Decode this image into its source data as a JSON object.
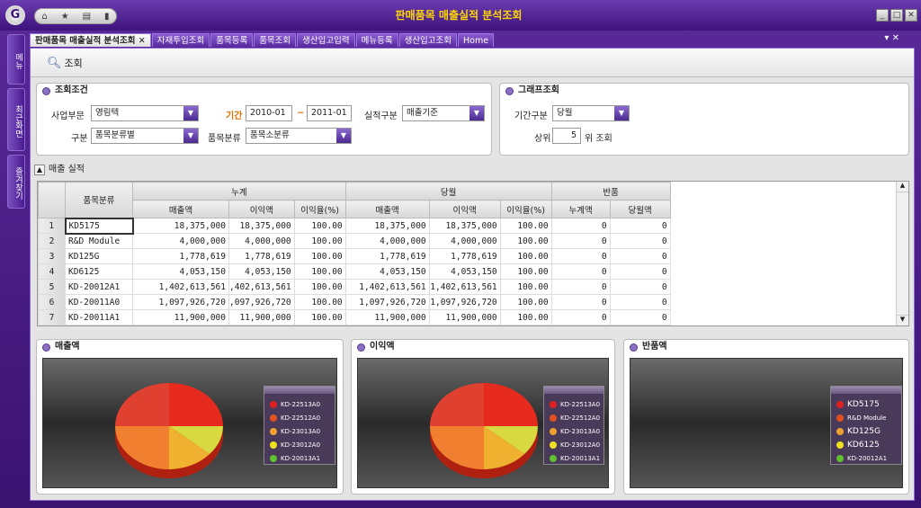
{
  "window": {
    "title": "판매품목 매출실적 분석조회",
    "logo": "G"
  },
  "left_tabs": [
    "메뉴",
    "최근화면",
    "즐겨찾기"
  ],
  "tabs": [
    {
      "label": "판매품목 매출실적 분석조회 ✕",
      "active": true
    },
    {
      "label": "자재투입조회"
    },
    {
      "label": "품목등록"
    },
    {
      "label": "품목조회"
    },
    {
      "label": "생산입고입력"
    },
    {
      "label": "메뉴등록"
    },
    {
      "label": "생산입고조회"
    },
    {
      "label": "Home"
    }
  ],
  "toolbar": {
    "search_label": "조회"
  },
  "conditions": {
    "title": "조회조건",
    "division_label": "사업부문",
    "division_value": "영림텍",
    "period_label": "기간",
    "period_from": "2010-01",
    "period_sep": "~",
    "period_to": "2011-01",
    "perf_label": "실적구분",
    "perf_value": "매출기준",
    "type_label": "구분",
    "type_value": "품목분류별",
    "item_class_label": "품목분류",
    "item_class_value": "품목소분류"
  },
  "graph_query": {
    "title": "그래프조회",
    "period_type_label": "기간구분",
    "period_type_value": "당월",
    "top_label": "상위",
    "top_value": "5",
    "top_suffix": "위 조회"
  },
  "section": {
    "title": "매출 실적"
  },
  "grid": {
    "group_headers": [
      "품목분류",
      "누계",
      "당월",
      "반품"
    ],
    "sub_headers": [
      "매출액",
      "이익액",
      "이익율(%)",
      "매출액",
      "이익액",
      "이익율(%)",
      "누계액",
      "당월액"
    ],
    "rows": [
      [
        "1",
        "KD5175",
        "18,375,000",
        "18,375,000",
        "100.00",
        "18,375,000",
        "18,375,000",
        "100.00",
        "0",
        "0"
      ],
      [
        "2",
        "R&D Module",
        "4,000,000",
        "4,000,000",
        "100.00",
        "4,000,000",
        "4,000,000",
        "100.00",
        "0",
        "0"
      ],
      [
        "3",
        "KD125G",
        "1,778,619",
        "1,778,619",
        "100.00",
        "1,778,619",
        "1,778,619",
        "100.00",
        "0",
        "0"
      ],
      [
        "4",
        "KD6125",
        "4,053,150",
        "4,053,150",
        "100.00",
        "4,053,150",
        "4,053,150",
        "100.00",
        "0",
        "0"
      ],
      [
        "5",
        "KD-20012A1",
        "1,402,613,561",
        ",402,613,561",
        "100.00",
        "1,402,613,561",
        "1,402,613,561",
        "100.00",
        "0",
        "0"
      ],
      [
        "6",
        "KD-20011A0",
        "1,097,926,720",
        ",097,926,720",
        "100.00",
        "1,097,926,720",
        "1,097,926,720",
        "100.00",
        "0",
        "0"
      ],
      [
        "7",
        "KD-20011A1",
        "11,900,000",
        "11,900,000",
        "100.00",
        "11,900,000",
        "11,900,000",
        "100.00",
        "0",
        "0"
      ]
    ]
  },
  "charts": [
    {
      "title": "매출액",
      "legend": [
        "KD-22513A0",
        "KD-22512A0",
        "KD-23013A0",
        "KD-23012A0",
        "KD-20013A1"
      ]
    },
    {
      "title": "이익액",
      "legend": [
        "KD-22513A0",
        "KD-22512A0",
        "KD-23013A0",
        "KD-23012A0",
        "KD-20013A1"
      ]
    },
    {
      "title": "반품액",
      "legend": [
        "KD5175",
        "R&D Module",
        "KD125G",
        "KD6125",
        "KD-20012A1"
      ]
    }
  ],
  "colors": {
    "accent": "#4a1a90",
    "title": "#ffd800",
    "legend": [
      "#e02020",
      "#e05020",
      "#f0a030",
      "#f0e020",
      "#60c030"
    ]
  }
}
